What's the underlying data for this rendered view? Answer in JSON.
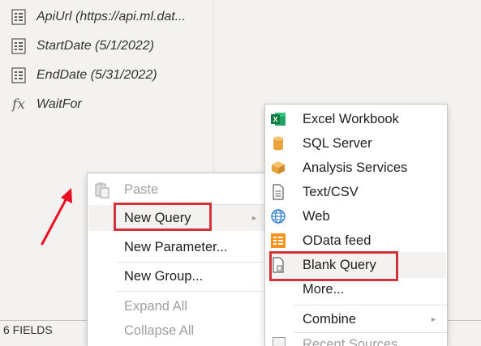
{
  "queries": [
    {
      "label": "ApiUrl (https://api.ml.dat...",
      "icon": "parameter-icon"
    },
    {
      "label": "StartDate (5/1/2022)",
      "icon": "parameter-icon"
    },
    {
      "label": "EndDate (5/31/2022)",
      "icon": "parameter-icon"
    },
    {
      "label": "WaitFor",
      "icon": "function-icon",
      "glyph": "fx"
    }
  ],
  "status": {
    "fields": "6 FIELDS"
  },
  "context_menu": {
    "items": [
      {
        "label": "Paste",
        "disabled": true,
        "icon": "paste-icon"
      },
      {
        "label": "New Query",
        "disabled": false,
        "submenu": true,
        "highlighted": true
      },
      {
        "label": "New Parameter...",
        "disabled": false
      },
      {
        "label": "New Group...",
        "disabled": false
      },
      {
        "label": "Expand All",
        "disabled": true
      },
      {
        "label": "Collapse All",
        "disabled": true
      }
    ]
  },
  "submenu": {
    "items": [
      {
        "label": "Excel Workbook",
        "icon": "excel-icon"
      },
      {
        "label": "SQL Server",
        "icon": "database-icon"
      },
      {
        "label": "Analysis Services",
        "icon": "cube-icon"
      },
      {
        "label": "Text/CSV",
        "icon": "document-icon"
      },
      {
        "label": "Web",
        "icon": "globe-icon"
      },
      {
        "label": "OData feed",
        "icon": "odata-icon"
      },
      {
        "label": "Blank Query",
        "icon": "blank-query-icon",
        "highlighted": true
      },
      {
        "label": "More...",
        "icon": null
      },
      {
        "label": "Combine",
        "icon": null,
        "submenu": true
      },
      {
        "label": "Recent Sources",
        "icon": "recent-icon",
        "partial": true
      }
    ]
  },
  "colors": {
    "highlight_border": "#d13438",
    "arrow": "#e81123",
    "excel_green": "#107c41",
    "sql_gold": "#e8a33d",
    "odata_orange": "#f7941d"
  }
}
